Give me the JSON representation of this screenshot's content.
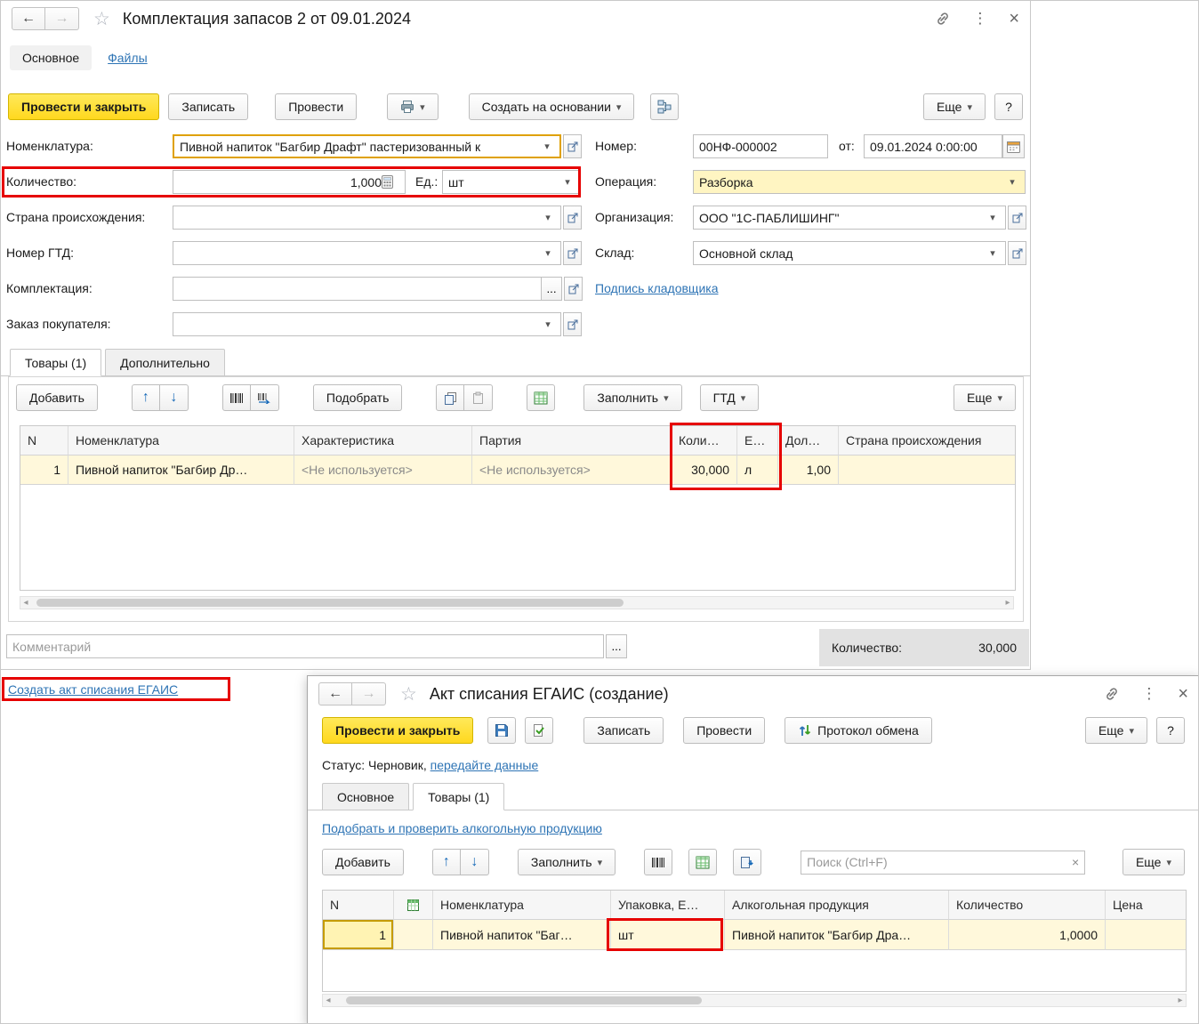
{
  "icons": {
    "back": "←",
    "forward": "→",
    "star": "☆",
    "kebab": "⋮",
    "close": "×",
    "dropdown": "▾",
    "up": "↑",
    "down": "↓",
    "ellipsis_button": "...",
    "scroll_left": "◂",
    "scroll_right": "▸",
    "clear": "×"
  },
  "main_window": {
    "title": "Комплектация запасов 2 от 09.01.2024",
    "nav": {
      "main_tab": "Основное",
      "files_tab": "Файлы"
    },
    "toolbar": {
      "post_and_close": "Провести и закрыть",
      "write": "Записать",
      "post": "Провести",
      "create_based_on": "Создать на основании",
      "more": "Еще",
      "help": "?"
    },
    "form": {
      "nomenclature_label": "Номенклатура:",
      "nomenclature_value": "Пивной напиток \"Багбир Драфт\" пастеризованный к",
      "quantity_label": "Количество:",
      "quantity_value": "1,000",
      "unit_label": "Ед.:",
      "unit_value": "шт",
      "country_label": "Страна происхождения:",
      "gtd_label": "Номер ГТД:",
      "kit_label": "Комплектация:",
      "customer_order_label": "Заказ покупателя:",
      "number_label": "Номер:",
      "number_value": "00НФ-000002",
      "date_label": "от:",
      "date_value": "09.01.2024  0:00:00",
      "operation_label": "Операция:",
      "operation_value": "Разборка",
      "organization_label": "Организация:",
      "organization_value": "ООО \"1С-ПАБЛИШИНГ\"",
      "warehouse_label": "Склад:",
      "warehouse_value": "Основной склад",
      "storekeeper_link": "Подпись кладовщика"
    },
    "section_tabs": {
      "goods": "Товары (1)",
      "additional": "Дополнительно"
    },
    "items_toolbar": {
      "add": "Добавить",
      "pick": "Подобрать",
      "fill": "Заполнить",
      "gtd": "ГТД",
      "more": "Еще"
    },
    "items_table": {
      "headers": [
        "N",
        "Номенклатура",
        "Характеристика",
        "Партия",
        "Коли…",
        "Е…",
        "Дол…",
        "Страна происхождения"
      ],
      "rows": [
        {
          "n": "1",
          "nomenclature": "Пивной напиток \"Багбир Др…",
          "characteristic": "<Не используется>",
          "batch": "<Не используется>",
          "quantity": "30,000",
          "unit": "л",
          "share": "1,00",
          "country": ""
        }
      ]
    },
    "comment_placeholder": "Комментарий",
    "footer": {
      "quantity_label": "Количество:",
      "quantity_value": "30,000"
    }
  },
  "create_act_link": "Создать акт списания ЕГАИС",
  "egais_window": {
    "title": "Акт списания ЕГАИС (создание)",
    "toolbar": {
      "post_and_close": "Провести и закрыть",
      "write": "Записать",
      "post": "Провести",
      "protocol": "Протокол обмена",
      "more": "Еще",
      "help": "?"
    },
    "status": {
      "label": "Статус:",
      "value": "Черновик,",
      "link": "передайте данные"
    },
    "tabs": {
      "main": "Основное",
      "goods": "Товары (1)"
    },
    "pick_link": "Подобрать и проверить алкогольную продукцию",
    "items_toolbar": {
      "add": "Добавить",
      "fill": "Заполнить",
      "more": "Еще",
      "search_placeholder": "Поиск (Ctrl+F)"
    },
    "items_table": {
      "headers": [
        "N",
        "",
        "Номенклатура",
        "Упаковка, Е…",
        "Алкогольная продукция",
        "Количество",
        "Цена"
      ],
      "rows": [
        {
          "n": "1",
          "nomenclature": "Пивной напиток \"Баг…",
          "package": "шт",
          "alcohol": "Пивной напиток \"Багбир Дра…",
          "quantity": "1,0000",
          "price": ""
        }
      ]
    }
  }
}
